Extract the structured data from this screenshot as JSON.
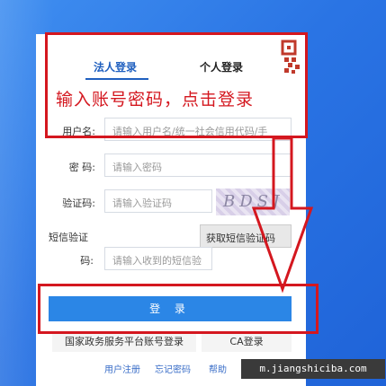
{
  "tabs": {
    "corporate": "法人登录",
    "personal": "个人登录"
  },
  "annotation": {
    "instruction": "输入账号密码，点击登录",
    "color": "#d4171f"
  },
  "form": {
    "username": {
      "label": "用户名:",
      "placeholder": "请输入用户名/统一社会信用代码/手"
    },
    "password": {
      "label": "密 码:",
      "placeholder": "请输入密码"
    },
    "captcha": {
      "label": "验证码:",
      "placeholder": "请输入验证码",
      "image_text": "BDSJ"
    },
    "sms": {
      "label_line1": "短信验证",
      "label_line2": "码:",
      "placeholder": "请输入收到的短信验",
      "button": "获取短信验证码"
    }
  },
  "buttons": {
    "login": "登 录",
    "national_login": "国家政务服务平台账号登录",
    "ca_login": "CA登录"
  },
  "footer": {
    "register": "用户注册",
    "forgot": "忘记密码",
    "help": "帮助"
  },
  "watermark": "m.jiangshiciba.com",
  "colors": {
    "primary": "#2b86e6",
    "tab_active": "#1f5fbf",
    "background": "#2a74e4"
  }
}
